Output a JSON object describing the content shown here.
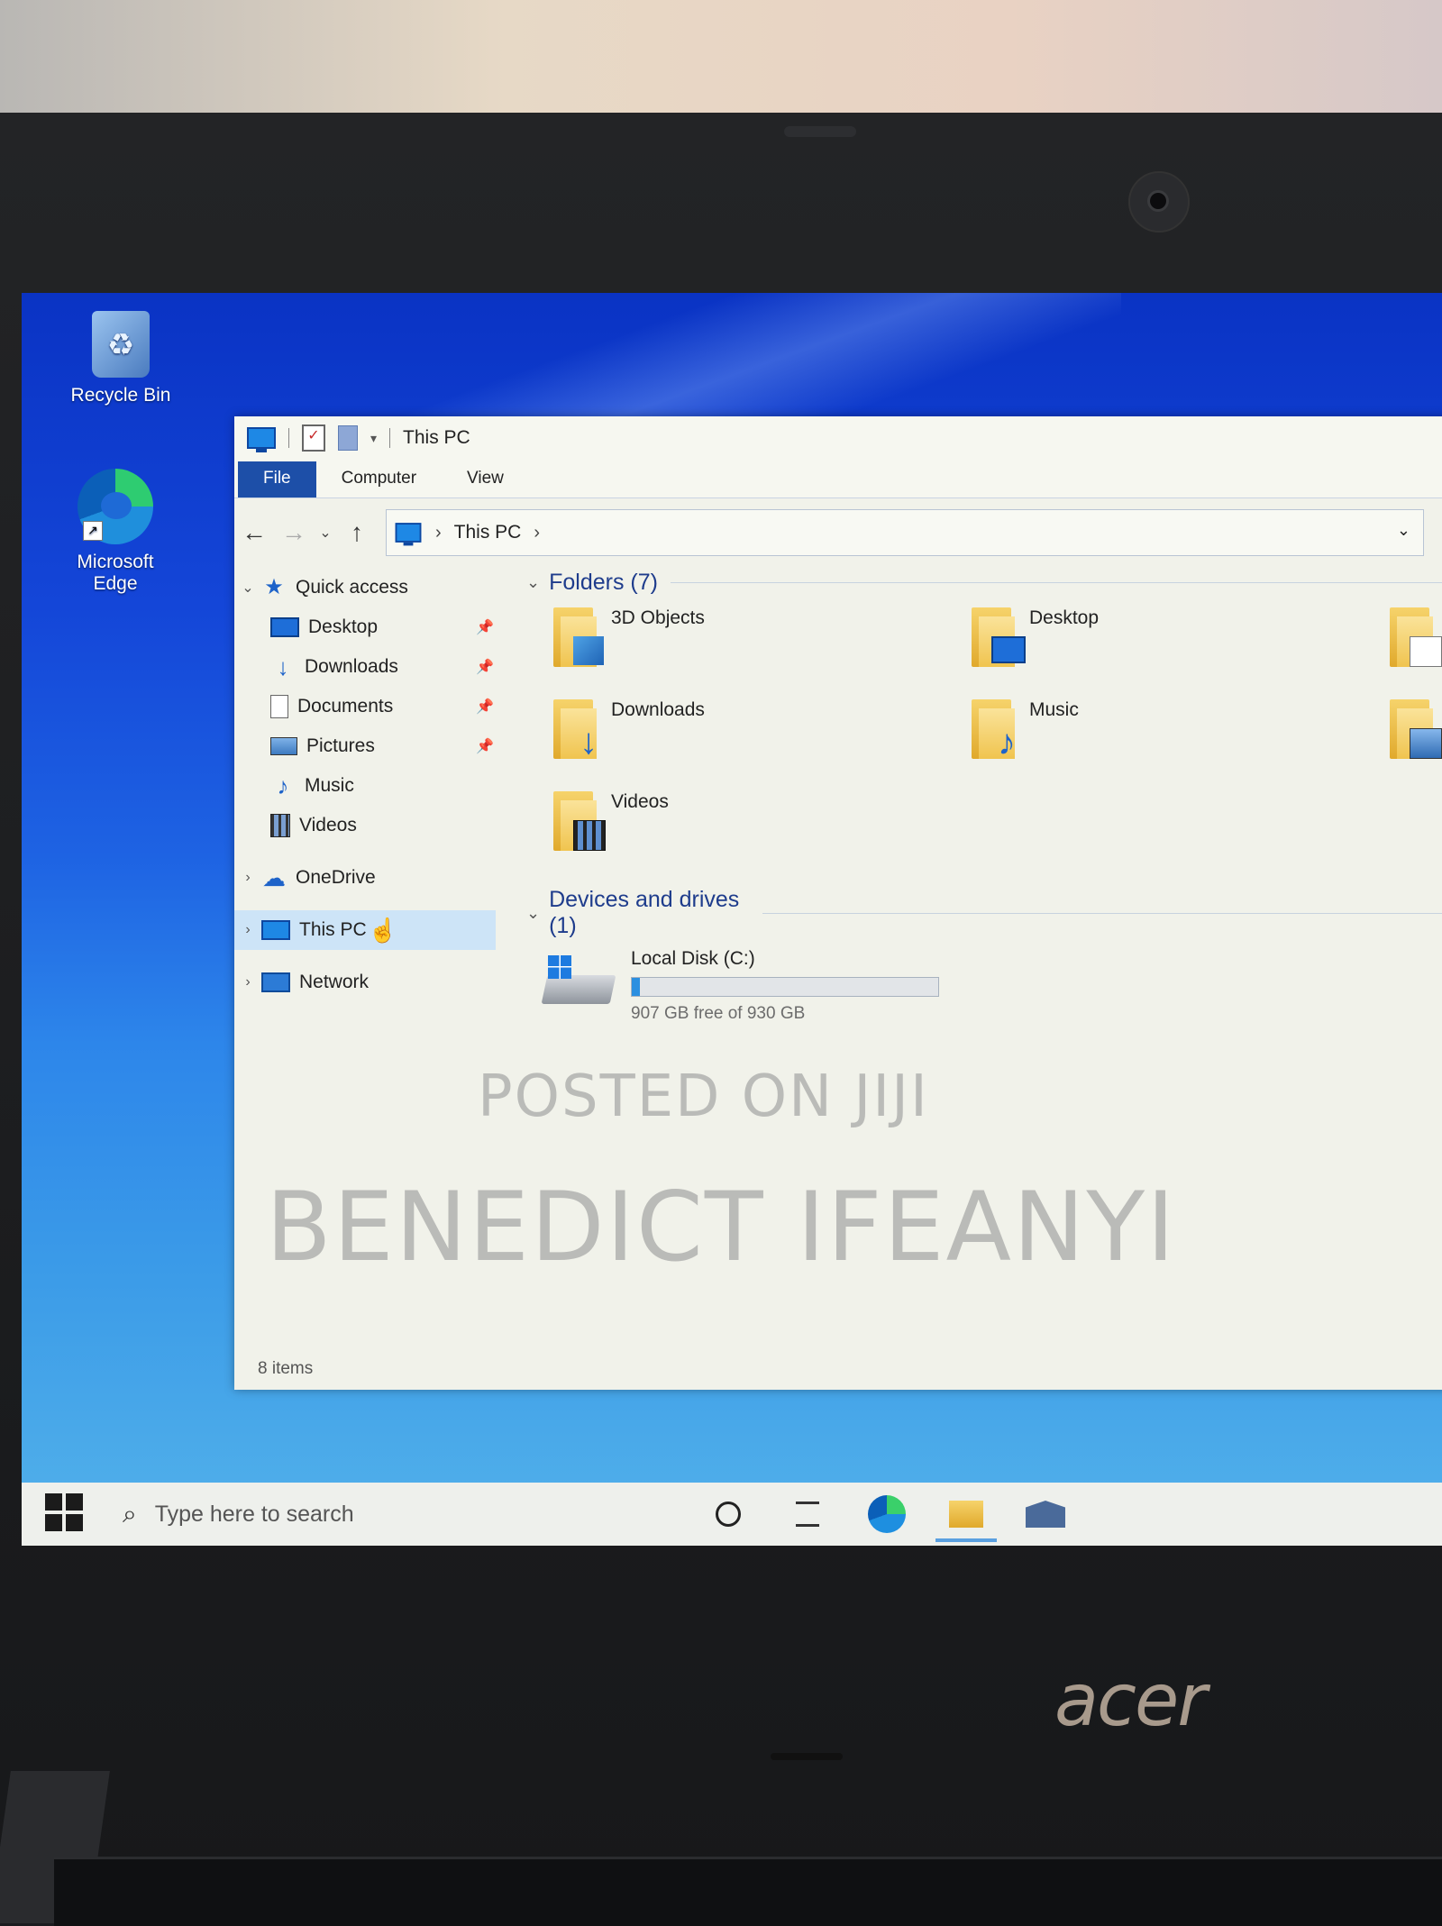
{
  "desktop": {
    "icons": [
      {
        "label": "Recycle Bin"
      },
      {
        "label": "Microsoft Edge"
      }
    ]
  },
  "window": {
    "title": "This PC",
    "ribbon_tabs": [
      "File",
      "Computer",
      "View"
    ],
    "address": {
      "location": "This PC"
    }
  },
  "nav_pane": {
    "quick_access": "Quick access",
    "items": [
      {
        "label": "Desktop",
        "pinned": true
      },
      {
        "label": "Downloads",
        "pinned": true
      },
      {
        "label": "Documents",
        "pinned": true
      },
      {
        "label": "Pictures",
        "pinned": true
      },
      {
        "label": "Music",
        "pinned": false
      },
      {
        "label": "Videos",
        "pinned": false
      }
    ],
    "onedrive": "OneDrive",
    "this_pc": "This PC",
    "network": "Network"
  },
  "content": {
    "folders_header": "Folders (7)",
    "folders": [
      "3D Objects",
      "Desktop",
      "Downloads",
      "Music",
      "Videos"
    ],
    "devices_header": "Devices and drives (1)",
    "drive": {
      "name": "Local Disk (C:)",
      "free_text": "907 GB free of 930 GB",
      "used_fraction": 0.025
    }
  },
  "status": {
    "items": "8 items"
  },
  "watermark": {
    "line1": "POSTED ON JIJI",
    "line2": "BENEDICT IFEANYI"
  },
  "taskbar": {
    "search_placeholder": "Type here to search"
  },
  "brand": {
    "logo": "acer"
  }
}
